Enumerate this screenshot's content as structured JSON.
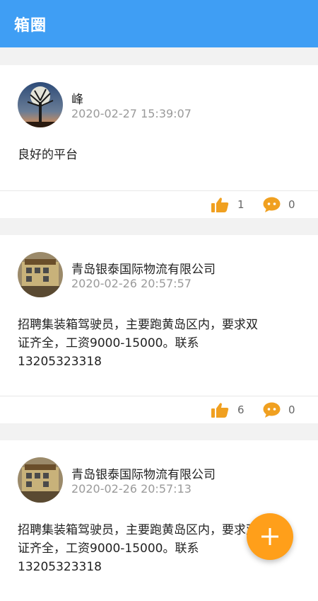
{
  "app_bar": {
    "title": "箱圈"
  },
  "posts": [
    {
      "author": "峰",
      "time": "2020-02-27 15:39:07",
      "content": "良好的平台",
      "likes": "1",
      "comments": "0"
    },
    {
      "author": "青岛银泰国际物流有限公司",
      "time": "2020-02-26 20:57:57",
      "content": "招聘集装箱驾驶员，主要跑黄岛区内，要求双证齐全，工资9000-15000。联系13205323318",
      "likes": "6",
      "comments": "0"
    },
    {
      "author": "青岛银泰国际物流有限公司",
      "time": "2020-02-26 20:57:13",
      "content": "招聘集装箱驾驶员，主要跑黄岛区内，要求双证齐全，工资9000-15000。联系13205323318"
    }
  ],
  "icons": {
    "like": "thumbs-up-icon",
    "comment": "speech-bubble-icon",
    "add": "plus-icon"
  },
  "colors": {
    "app_bar": "#3f9ef4",
    "accent": "#ff9f1a",
    "meta_text": "#9a9a9a"
  }
}
